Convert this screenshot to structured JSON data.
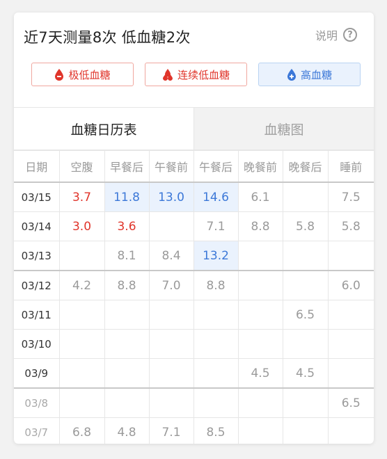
{
  "header": {
    "title": "近7天测量8次 低血糖2次",
    "help_label": "说明",
    "help_icon": "question-circle-icon"
  },
  "legend": [
    {
      "label": "极低血糖",
      "icon": "minus-drop-icon",
      "color": "#e0352b"
    },
    {
      "label": "连续低血糖",
      "icon": "double-drop-icon",
      "color": "#e0352b"
    },
    {
      "label": "高血糖",
      "icon": "plus-drop-icon",
      "color": "#3c78d8"
    }
  ],
  "tabs": [
    {
      "label": "血糖日历表",
      "active": true
    },
    {
      "label": "血糖图",
      "active": false
    }
  ],
  "columns": [
    "日期",
    "空腹",
    "早餐后",
    "午餐前",
    "午餐后",
    "晚餐前",
    "晚餐后",
    "睡前"
  ],
  "rows": [
    {
      "date": "03/15",
      "values": [
        "3.7",
        "11.8",
        "13.0",
        "14.6",
        "6.1",
        "",
        "7.5"
      ]
    },
    {
      "date": "03/14",
      "values": [
        "3.0",
        "3.6",
        "",
        "7.1",
        "8.8",
        "5.8",
        "5.8"
      ]
    },
    {
      "date": "03/13",
      "values": [
        "",
        "8.1",
        "8.4",
        "13.2",
        "",
        "",
        ""
      ]
    },
    {
      "date": "03/12",
      "values": [
        "4.2",
        "8.8",
        "7.0",
        "8.8",
        "",
        "",
        "6.0"
      ]
    },
    {
      "date": "03/11",
      "values": [
        "",
        "",
        "",
        "",
        "",
        "6.5",
        ""
      ]
    },
    {
      "date": "03/10",
      "values": [
        "",
        "",
        "",
        "",
        "",
        "",
        ""
      ]
    },
    {
      "date": "03/9",
      "values": [
        "",
        "",
        "",
        "",
        "4.5",
        "4.5",
        ""
      ]
    },
    {
      "date": "03/8",
      "values": [
        "",
        "",
        "",
        "",
        "",
        "",
        "6.5"
      ]
    },
    {
      "date": "03/7",
      "values": [
        "6.8",
        "4.8",
        "7.1",
        "8.5",
        "",
        "",
        ""
      ]
    }
  ]
}
